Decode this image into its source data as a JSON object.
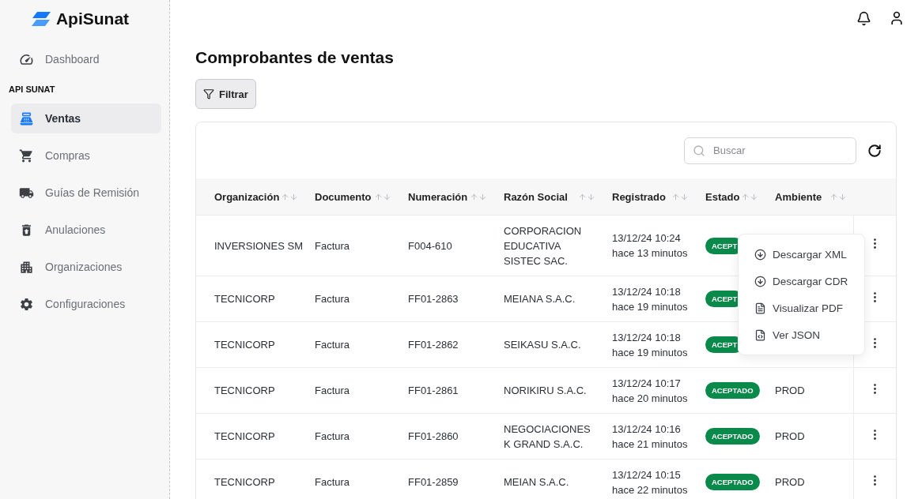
{
  "brand": "ApiSunat",
  "sidebar": {
    "items": [
      {
        "label": "Dashboard",
        "kind": "dashboard",
        "selected": false
      },
      {
        "label": "API SUNAT",
        "kind": "section"
      },
      {
        "label": "Ventas",
        "kind": "sales",
        "selected": true
      },
      {
        "label": "Compras",
        "kind": "cart",
        "selected": false
      },
      {
        "label": "Guías de Remisión",
        "kind": "truck",
        "selected": false
      },
      {
        "label": "Anulaciones",
        "kind": "trash",
        "selected": false
      },
      {
        "label": "Organizaciones",
        "kind": "building",
        "selected": false
      },
      {
        "label": "Configuraciones",
        "kind": "gear",
        "selected": false
      }
    ]
  },
  "page_title": "Comprobantes de ventas",
  "filter_button": "Filtrar",
  "search": {
    "placeholder": "Buscar"
  },
  "table": {
    "columns": [
      "Organización",
      "Documento",
      "Numeración",
      "Razón Social",
      "Registrado",
      "Estado",
      "Ambiente"
    ],
    "rows": [
      {
        "organization": "INVERSIONES SM",
        "document": "Factura",
        "number": "F004-610",
        "company": "CORPORACION EDUCATIVA SISTEC SAC.",
        "date": "13/12/24 10:24",
        "ago": "hace 13 minutos",
        "status": "ACEPT"
      },
      {
        "organization": "TECNICORP",
        "document": "Factura",
        "number": "FF01-2863",
        "company": "MEIANA S.A.C.",
        "date": "13/12/24 10:18",
        "ago": "hace 19 minutos",
        "status": "ACEPT"
      },
      {
        "organization": "TECNICORP",
        "document": "Factura",
        "number": "FF01-2862",
        "company": "SEIKASU S.A.C.",
        "date": "13/12/24 10:18",
        "ago": "hace 19 minutos",
        "status": "ACEPT"
      },
      {
        "organization": "TECNICORP",
        "document": "Factura",
        "number": "FF01-2861",
        "company": "NORIKIRU S.A.C.",
        "date": "13/12/24 10:17",
        "ago": "hace 20 minutos",
        "status": "ACEPTADO",
        "environment": "PROD"
      },
      {
        "organization": "TECNICORP",
        "document": "Factura",
        "number": "FF01-2860",
        "company": "NEGOCIACIONES K GRAND S.A.C.",
        "date": "13/12/24 10:16",
        "ago": "hace 21 minutos",
        "status": "ACEPTADO",
        "environment": "PROD"
      },
      {
        "organization": "TECNICORP",
        "document": "Factura",
        "number": "FF01-2859",
        "company": "MEIAN S.A.C.",
        "date": "13/12/24 10:15",
        "ago": "hace 22 minutos",
        "status": "ACEPTADO",
        "environment": "PROD"
      }
    ]
  },
  "row_menu": {
    "items": [
      {
        "label": "Descargar XML",
        "kind": "download"
      },
      {
        "label": "Descargar CDR",
        "kind": "download"
      },
      {
        "label": "Visualizar PDF",
        "kind": "file"
      },
      {
        "label": "Ver JSON",
        "kind": "code"
      }
    ]
  }
}
